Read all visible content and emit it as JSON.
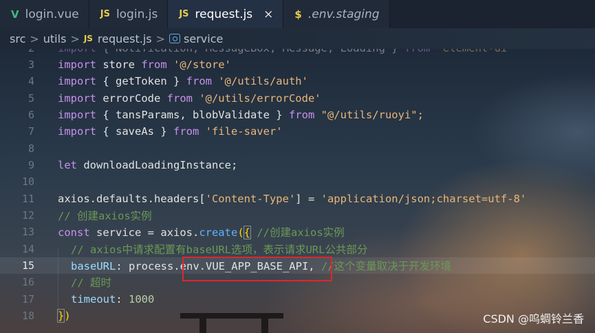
{
  "tabs": [
    {
      "icon": "V",
      "icon_name": "vue-file-icon",
      "label": "login.vue",
      "active": false
    },
    {
      "icon": "JS",
      "icon_name": "js-file-icon",
      "label": "login.js",
      "active": false
    },
    {
      "icon": "JS",
      "icon_name": "js-file-icon",
      "label": "request.js",
      "active": true,
      "close": "×"
    },
    {
      "icon": "$",
      "icon_name": "env-file-icon",
      "label": ".env.staging",
      "active": false
    }
  ],
  "breadcrumb": {
    "parts": [
      "src",
      "utils"
    ],
    "file_icon": "JS",
    "file": "request.js",
    "symbol": "service",
    "separator": ">"
  },
  "line_numbers": [
    "2",
    "3",
    "4",
    "5",
    "6",
    "7",
    "8",
    "9",
    "10",
    "11",
    "12",
    "13",
    "14",
    "15",
    "16",
    "17",
    "18"
  ],
  "current_line": "15",
  "code": {
    "l2": [
      "import",
      " { Notification, MessageBox, Message, Loading } ",
      "from",
      " 'element-ui'"
    ],
    "l3": [
      "import",
      " store ",
      "from",
      " '@/store'"
    ],
    "l4": [
      "import",
      " { getToken } ",
      "from",
      " '@/utils/auth'"
    ],
    "l5": [
      "import",
      " errorCode ",
      "from",
      " '@/utils/errorCode'"
    ],
    "l6": [
      "import",
      " { tansParams, blobValidate } ",
      "from",
      " \"@/utils/ruoyi\";"
    ],
    "l7": [
      "import",
      " { saveAs } ",
      "from",
      " 'file-saver'"
    ],
    "l9": [
      "let",
      " downloadLoadingInstance;"
    ],
    "l11": [
      "axios.defaults.headers[",
      "'Content-Type'",
      "] = ",
      "'application/json;charset=utf-8'"
    ],
    "l12": "// 创建axios实例",
    "l13": [
      "const",
      " service = axios.",
      "create",
      "(",
      "{",
      " ",
      "//创建axios实例"
    ],
    "l14": "// axios中请求配置有baseURL选项，表示请求URL公共部分",
    "l15": [
      "baseURL",
      ": process.",
      "env.VUE_APP_BASE_API",
      ", ",
      "//这个变量取决于开发环境"
    ],
    "l16": "// 超时",
    "l17": [
      "timeout",
      ": ",
      "1000"
    ],
    "l18": [
      "}",
      ")"
    ]
  },
  "watermark": "CSDN @呜蜩铃兰香",
  "colors": {
    "keyword": "#c792ea",
    "string": "#e8b67a",
    "comment": "#6a9955",
    "number": "#b5cea8",
    "highlight_box": "#e0262c"
  }
}
